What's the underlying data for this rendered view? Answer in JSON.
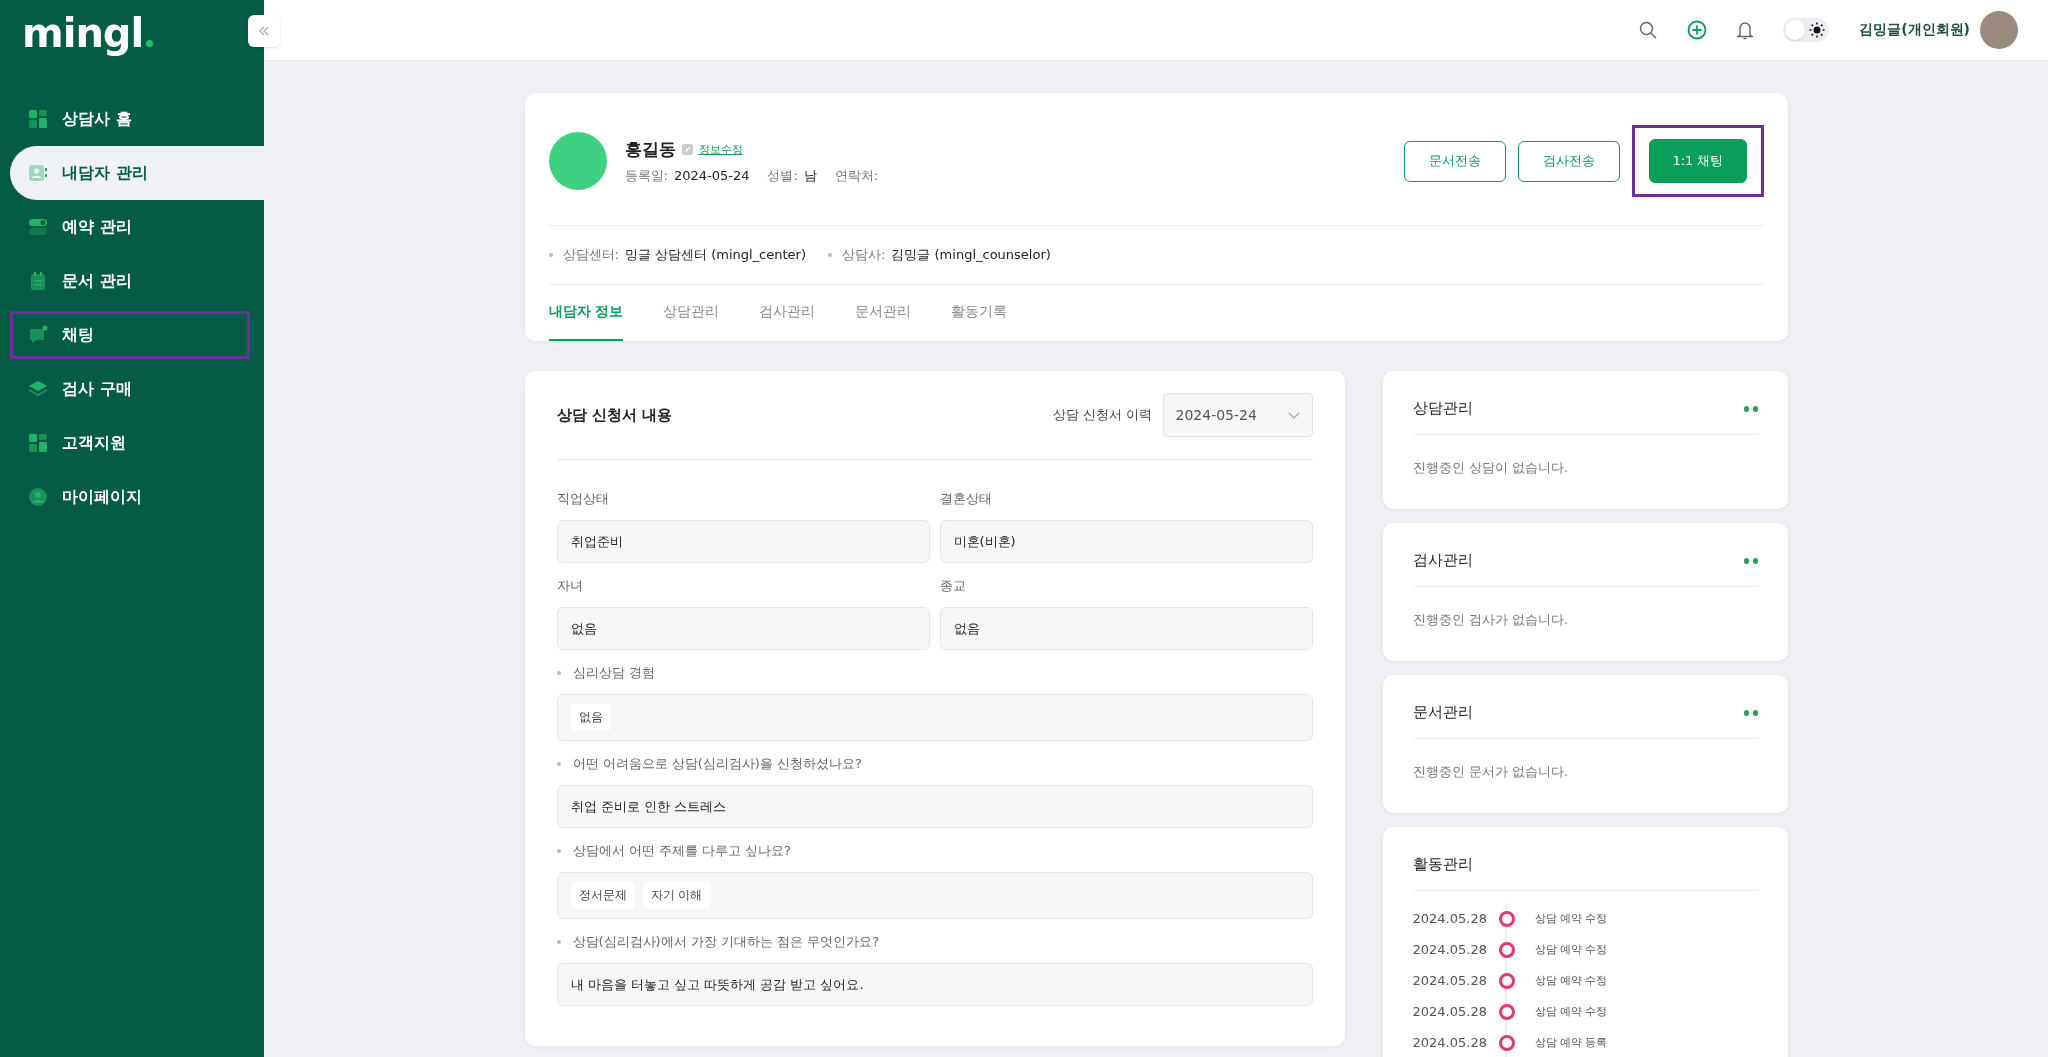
{
  "logo": {
    "text": "mingl"
  },
  "sidebar": {
    "items": [
      {
        "label": "상담사 홈",
        "kind": "grid",
        "selected": false,
        "highlighted": false
      },
      {
        "label": "내담자 관리",
        "kind": "contact",
        "selected": true,
        "highlighted": false
      },
      {
        "label": "예약 관리",
        "kind": "toggle",
        "selected": false,
        "highlighted": false
      },
      {
        "label": "문서 관리",
        "kind": "doc",
        "selected": false,
        "highlighted": false
      },
      {
        "label": "채팅",
        "kind": "chat",
        "selected": false,
        "highlighted": true
      },
      {
        "label": "검사 구매",
        "kind": "layers",
        "selected": false,
        "highlighted": false
      },
      {
        "label": "고객지원",
        "kind": "grid",
        "selected": false,
        "highlighted": false
      },
      {
        "label": "마이페이지",
        "kind": "person",
        "selected": false,
        "highlighted": false
      }
    ]
  },
  "topbar": {
    "dark_mode": false,
    "user_name": "김밍글(개인회원)"
  },
  "profile": {
    "name": "홍길동",
    "edit_link": "정보수정",
    "meta": [
      {
        "label": "등록일:",
        "value": "2024-05-24"
      },
      {
        "label": "성별:",
        "value": "남"
      },
      {
        "label": "연락처:"
      }
    ],
    "buttons": [
      {
        "label": "문서전송",
        "kind": "outline",
        "highlighted": false
      },
      {
        "label": "검사전송",
        "kind": "outline",
        "highlighted": false
      },
      {
        "label": "1:1 채팅",
        "kind": "primary",
        "highlighted": true
      }
    ],
    "details": [
      {
        "label": "상담센터:",
        "value": "밍글 상담센터 (mingl_center)"
      },
      {
        "label": "상담사:",
        "value": "김밍글 (mingl_counselor)"
      }
    ],
    "tabs": [
      {
        "label": "내담자 정보",
        "selected": true
      },
      {
        "label": "상담관리",
        "selected": false
      },
      {
        "label": "검사관리",
        "selected": false
      },
      {
        "label": "문서관리",
        "selected": false
      },
      {
        "label": "활동기록",
        "selected": false
      }
    ]
  },
  "form": {
    "title": "상담 신청서 내용",
    "history_label": "상담 신청서 이력",
    "history_value": "2024-05-24",
    "pairs": [
      [
        {
          "label": "직업상태",
          "value": "취업준비"
        },
        {
          "label": "결혼상태",
          "value": "미혼(비혼)"
        }
      ],
      [
        {
          "label": "자녀",
          "value": "없음"
        },
        {
          "label": "종교",
          "value": "없음"
        }
      ]
    ],
    "questions": [
      {
        "label": "심리상담 경험",
        "kind": "chips",
        "chips": [
          "없음"
        ]
      },
      {
        "label": "어떤 어려움으로 상담(심리검사)을 신청하셨나요?",
        "kind": "text",
        "value": "취업 준비로 인한 스트레스"
      },
      {
        "label": "상담에서 어떤 주제를 다루고 싶나요?",
        "kind": "chips",
        "chips": [
          "정서문제",
          "자기 이해"
        ]
      },
      {
        "label": "상담(심리검사)에서 가장 기대하는 점은 무엇인가요?",
        "kind": "text",
        "value": "내 마음을 터놓고 싶고 따뜻하게 공감 받고 싶어요."
      }
    ]
  },
  "side_cards": [
    {
      "title": "상담관리",
      "empty": "진행중인 상담이 없습니다."
    },
    {
      "title": "검사관리",
      "empty": "진행중인 검사가 없습니다."
    },
    {
      "title": "문서관리",
      "empty": "진행중인 문서가 없습니다."
    }
  ],
  "activity": {
    "title": "활동관리",
    "items": [
      {
        "date": "2024.05.28",
        "label": "상담 예약 수정"
      },
      {
        "date": "2024.05.28",
        "label": "상담 예약 수정"
      },
      {
        "date": "2024.05.28",
        "label": "상담 예약 수정"
      },
      {
        "date": "2024.05.28",
        "label": "상담 예약 수정"
      },
      {
        "date": "2024.05.28",
        "label": "상담 예약 등록"
      }
    ]
  }
}
